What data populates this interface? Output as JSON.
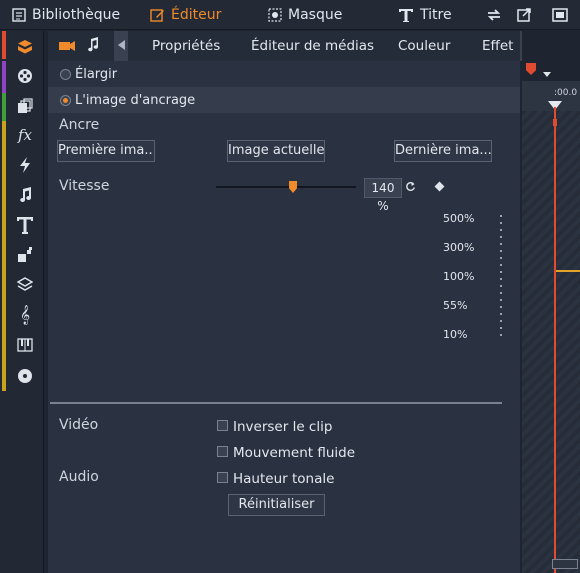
{
  "topbar": {
    "library": "Bibliothèque",
    "editor": "Éditeur",
    "mask": "Masque",
    "title": "Titre"
  },
  "subtabs": [
    "Propriétés",
    "Éditeur de médias",
    "Couleur",
    "Effet"
  ],
  "options": {
    "enlarge": "Élargir",
    "anchor_image": "L'image d'ancrage"
  },
  "anchor": {
    "label": "Ancre",
    "first": "Première ima...",
    "current": "Image actuelle",
    "last": "Dernière ima..."
  },
  "speed": {
    "label": "Vitesse",
    "value": "140 %",
    "scale": [
      "500%",
      "300%",
      "100%",
      "55%",
      "10%"
    ]
  },
  "video": {
    "label": "Vidéo",
    "reverse": "Inverser le clip",
    "smooth": "Mouvement fluide"
  },
  "audio": {
    "label": "Audio",
    "pitch": "Hauteur tonale",
    "reset": "Réinitialiser"
  },
  "timeline": {
    "time": ":00.0"
  },
  "colors": {
    "accent": "#f08a2a",
    "playhead": "#e14b2f"
  }
}
